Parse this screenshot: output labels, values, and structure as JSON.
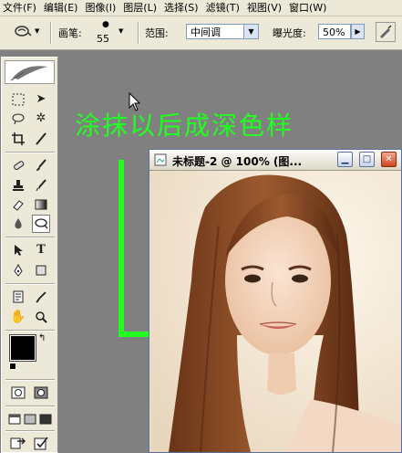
{
  "menubar": {
    "items": [
      "文件(F)",
      "编辑(E)",
      "图像(I)",
      "图层(L)",
      "选择(S)",
      "滤镜(T)",
      "视图(V)",
      "窗口(W)"
    ]
  },
  "options": {
    "brush_label": "画笔:",
    "brush_size": "55",
    "range_label": "范围:",
    "range_value": "中间调",
    "exposure_label": "曝光度:",
    "exposure_value": "50%",
    "tool_icon": "burn-tool-icon"
  },
  "toolbox": {
    "tools": [
      "feather-logo",
      "rect-marquee-icon",
      "move-icon",
      "lasso-icon",
      "magic-wand-icon",
      "crop-icon",
      "slice-icon",
      "healing-brush-icon",
      "brush-icon",
      "clone-stamp-icon",
      "history-brush-icon",
      "eraser-icon",
      "gradient-icon",
      "blur-icon",
      "burn-tool-icon",
      "path-select-icon",
      "type-icon",
      "pen-icon",
      "shape-icon",
      "notes-icon",
      "eyedropper-icon",
      "hand-icon",
      "zoom-icon"
    ]
  },
  "annotation": {
    "text": "涂抹以后成深色样",
    "color": "#20ff20"
  },
  "document": {
    "title": "未标题-2 @ 100% (图..."
  }
}
